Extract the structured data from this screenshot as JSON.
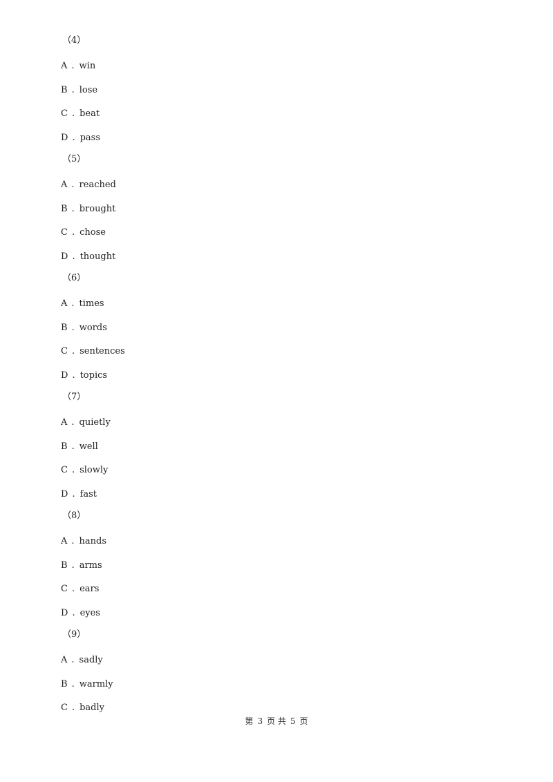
{
  "questions": [
    {
      "number": "（4）",
      "options": [
        {
          "letter": "A",
          "text": "win"
        },
        {
          "letter": "B",
          "text": "lose"
        },
        {
          "letter": "C",
          "text": "beat"
        },
        {
          "letter": "D",
          "text": "pass"
        }
      ]
    },
    {
      "number": "（5）",
      "options": [
        {
          "letter": "A",
          "text": "reached"
        },
        {
          "letter": "B",
          "text": "brought"
        },
        {
          "letter": "C",
          "text": "chose"
        },
        {
          "letter": "D",
          "text": "thought"
        }
      ]
    },
    {
      "number": "（6）",
      "options": [
        {
          "letter": "A",
          "text": "times"
        },
        {
          "letter": "B",
          "text": "words"
        },
        {
          "letter": "C",
          "text": "sentences"
        },
        {
          "letter": "D",
          "text": "topics"
        }
      ]
    },
    {
      "number": "（7）",
      "options": [
        {
          "letter": "A",
          "text": "quietly"
        },
        {
          "letter": "B",
          "text": "well"
        },
        {
          "letter": "C",
          "text": "slowly"
        },
        {
          "letter": "D",
          "text": "fast"
        }
      ]
    },
    {
      "number": "（8）",
      "options": [
        {
          "letter": "A",
          "text": "hands"
        },
        {
          "letter": "B",
          "text": "arms"
        },
        {
          "letter": "C",
          "text": "ears"
        },
        {
          "letter": "D",
          "text": "eyes"
        }
      ]
    },
    {
      "number": "（9）",
      "options": [
        {
          "letter": "A",
          "text": "sadly"
        },
        {
          "letter": "B",
          "text": "warmly"
        },
        {
          "letter": "C",
          "text": "badly"
        }
      ]
    }
  ],
  "separator": ".",
  "footer": {
    "prefix": "第",
    "current_page": "3",
    "mid": "页 共",
    "total_pages": "5",
    "suffix": "页"
  }
}
